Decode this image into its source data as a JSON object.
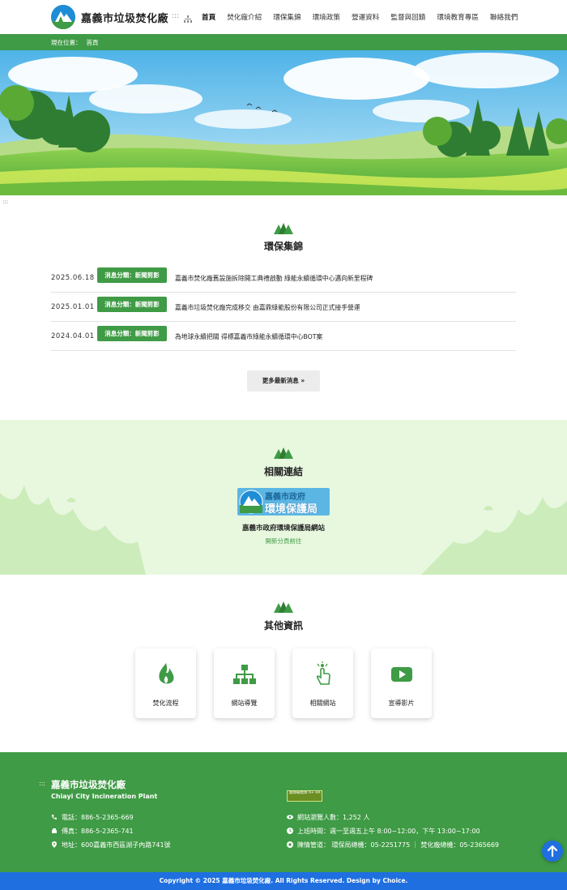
{
  "header": {
    "site_title": "嘉義市垃圾焚化廠",
    "access_key": ":::",
    "nav": [
      {
        "label": "首頁",
        "active": true
      },
      {
        "label": "焚化廠介紹"
      },
      {
        "label": "環保集錦"
      },
      {
        "label": "環境政策"
      },
      {
        "label": "營運資料"
      },
      {
        "label": "監督與回饋"
      },
      {
        "label": "環境教育專區"
      },
      {
        "label": "聯絡我們"
      }
    ]
  },
  "breadcrumb": {
    "prefix": "現在位置：",
    "current": "首頁"
  },
  "content_access_key": ":::",
  "news": {
    "title": "環保集錦",
    "items": [
      {
        "date": "2025.06.18",
        "tag": "消息分類：新聞剪影",
        "title": "嘉義市焚化廠舊設施拆除開工典禮啟動 綠能永續循環中心邁向新里程碑"
      },
      {
        "date": "2025.01.01",
        "tag": "消息分類：新聞剪影",
        "title": "嘉義市垃圾焚化廠完成移交 由嘉鼎綠能股份有限公司正式接手營運"
      },
      {
        "date": "2024.04.01",
        "tag": "消息分類：新聞剪影",
        "title": "為地球永續把關 得標嘉義市綠能永續循環中心BOT案"
      }
    ],
    "more_label": "更多最新消息 »"
  },
  "related": {
    "title": "相關連結",
    "logo_line1": "嘉義市政府",
    "logo_line2": "環境保護局",
    "link_name": "嘉義市政府環境保護局網站",
    "link_note": "開新分頁前往"
  },
  "other": {
    "title": "其他資訊",
    "cards": [
      {
        "label": "焚化流程",
        "icon": "flame-icon"
      },
      {
        "label": "網站導覽",
        "icon": "sitemap-icon"
      },
      {
        "label": "相關網站",
        "icon": "touch-icon"
      },
      {
        "label": "宣導影片",
        "icon": "video-play-icon"
      }
    ]
  },
  "footer": {
    "access_key": ":::",
    "title": "嘉義市垃圾焚化廠",
    "subtitle": "Chiayi City Incineration Plant",
    "phone": "電話：886-5-2365-669",
    "fax": "傳真：886-5-2365-741",
    "address": "地址：600嘉義市西區湖子內路741號",
    "badge": "無障礙標章 A+ AA",
    "visitors": "網站瀏覽人數：1,252 人",
    "hours": "上班時間：週一至週五上午 8:00~12:00，下午 13:00~17:00",
    "complaint": "陳情管道： 環保局總機：05-2251775 ｜ 焚化廠總機：05-2365669",
    "copyright": "Copyright © 2025 嘉義市垃圾焚化廠. All Rights Reserved. Design by Choice."
  },
  "colors": {
    "brand_green": "#3f9b45",
    "light_green_bg": "#e8f8df",
    "blue_accent": "#1f6fe0"
  }
}
